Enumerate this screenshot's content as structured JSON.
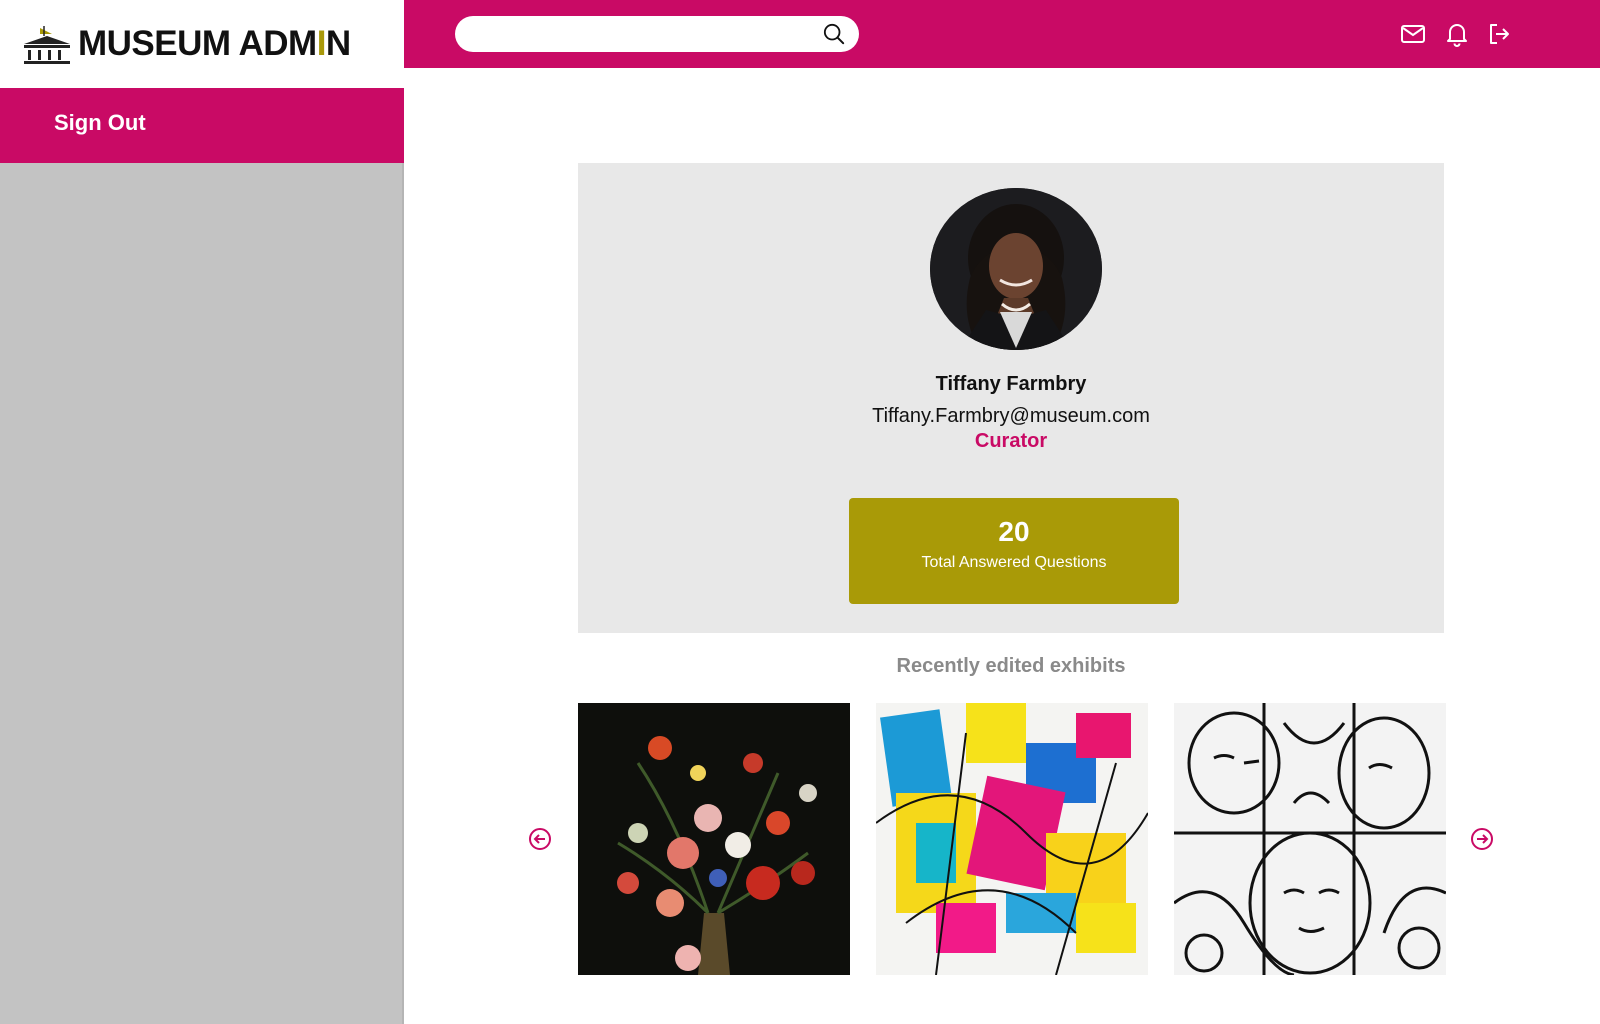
{
  "brand": {
    "name_main": "MUSEUM ADM",
    "name_accent": "I",
    "name_tail": "N"
  },
  "header": {
    "search_placeholder": "",
    "icons": [
      "mail-icon",
      "bell-icon",
      "logout-icon"
    ]
  },
  "sidebar": {
    "sign_out_label": "Sign Out"
  },
  "profile": {
    "name": "Tiffany Farmbry",
    "email": "Tiffany.Farmbry@museum.com",
    "role": "Curator",
    "stat_value": "20",
    "stat_label": "Total Answered Questions"
  },
  "exhibits": {
    "title": "Recently edited exhibits",
    "items": [
      "floral-still-life-painting",
      "colorful-abstract-painting",
      "black-white-line-art"
    ]
  },
  "colors": {
    "brand": "#c90a65",
    "accent": "#a99a07",
    "sidebar": "#c3c3c3",
    "card": "#e8e8e8"
  }
}
